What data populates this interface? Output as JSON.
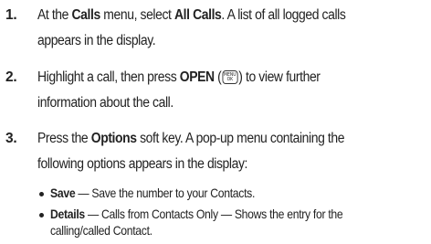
{
  "steps": [
    {
      "num": "1.",
      "line1_pre": "At the ",
      "line1_b1": "Calls",
      "line1_mid": " menu, select ",
      "line1_b2": "All Calls",
      "line1_post": ". A list of all logged calls",
      "line2": "appears in the display."
    },
    {
      "num": "2.",
      "line1_pre": "Highlight a call, then press ",
      "line1_b1": "OPEN",
      "line1_open": " (",
      "key_top": "MENU",
      "key_bottom": "OK",
      "line1_post": ") to view further",
      "line2": "information about the call."
    },
    {
      "num": "3.",
      "line1_pre": "Press the ",
      "line1_b1": "Options",
      "line1_post": " soft key. A pop-up menu containing the",
      "line2": "following options appears in the display:"
    }
  ],
  "bullets": [
    {
      "term": "Save",
      "line1": " — Save the number to your Contacts."
    },
    {
      "term": "Details",
      "line1": " — Calls from Contacts Only — Shows the entry for the",
      "line2": "calling/called Contact."
    }
  ]
}
